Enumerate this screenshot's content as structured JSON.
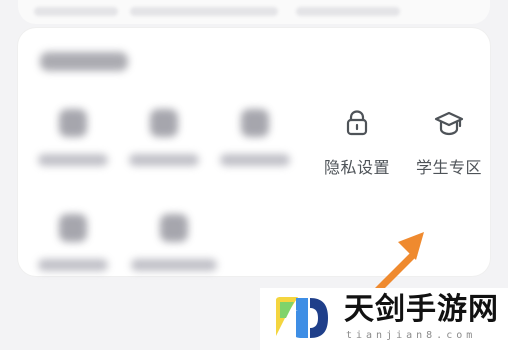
{
  "services": {
    "privacy": {
      "label": "隐私设置",
      "icon": "lock-icon"
    },
    "student": {
      "label": "学生专区",
      "icon": "graduation-cap-icon"
    }
  },
  "watermark": {
    "brand": "天剑手游网",
    "domain": "tianjian8.com",
    "logo": "tianjian-logo"
  },
  "colors": {
    "label": "#4e5358",
    "icon": "#4e5358",
    "card": "#ffffff",
    "background": "#f3f3f5",
    "arrow": "#ef8a2f"
  }
}
